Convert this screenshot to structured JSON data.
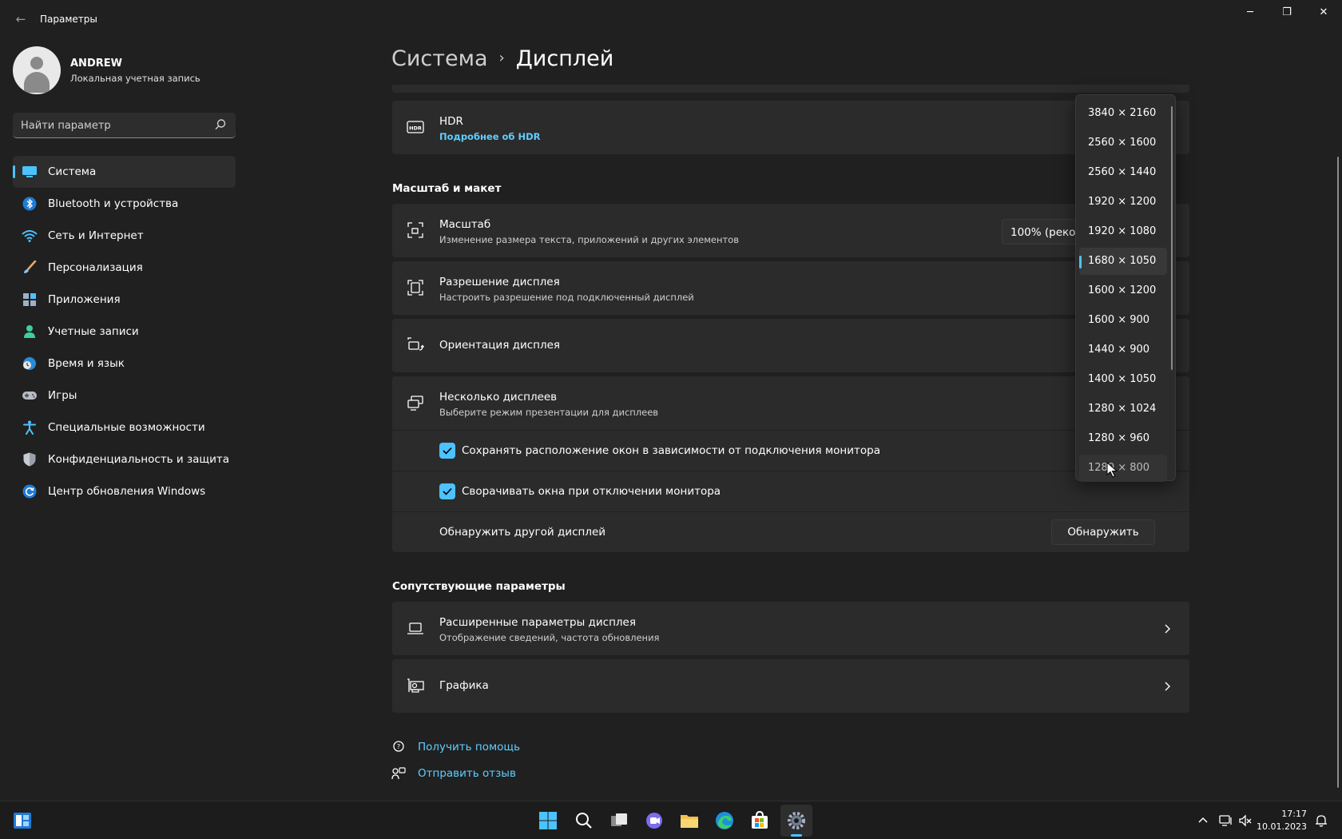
{
  "window": {
    "title": "Параметры",
    "minimize_glyph": "─",
    "maximize_glyph": "❐",
    "close_glyph": "✕",
    "back_glyph": "←"
  },
  "profile": {
    "name": "ANDREW",
    "account_type": "Локальная учетная запись"
  },
  "search": {
    "placeholder": "Найти параметр"
  },
  "nav": {
    "items": [
      {
        "label": "Система",
        "icon": "monitor-icon",
        "active": true
      },
      {
        "label": "Bluetooth и устройства",
        "icon": "bluetooth-icon"
      },
      {
        "label": "Сеть и Интернет",
        "icon": "wifi-icon"
      },
      {
        "label": "Персонализация",
        "icon": "brush-icon"
      },
      {
        "label": "Приложения",
        "icon": "apps-icon"
      },
      {
        "label": "Учетные записи",
        "icon": "person-icon"
      },
      {
        "label": "Время и язык",
        "icon": "clock-globe-icon"
      },
      {
        "label": "Игры",
        "icon": "gamepad-icon"
      },
      {
        "label": "Специальные возможности",
        "icon": "accessibility-icon"
      },
      {
        "label": "Конфиденциальность и защита",
        "icon": "shield-icon"
      },
      {
        "label": "Центр обновления Windows",
        "icon": "update-icon"
      }
    ]
  },
  "breadcrumb": {
    "parent": "Система",
    "separator": "›",
    "current": "Дисплей"
  },
  "hdr": {
    "title": "HDR",
    "link": "Подробнее об HDR"
  },
  "scale_layout": {
    "section_title": "Масштаб и макет",
    "scale": {
      "title": "Масштаб",
      "subtitle": "Изменение размера текста, приложений и других элементов",
      "value": "100% (рекомендуется)"
    },
    "resolution": {
      "title": "Разрешение дисплея",
      "subtitle": "Настроить разрешение под подключенный дисплей"
    },
    "orientation": {
      "title": "Ориентация дисплея"
    },
    "multiple": {
      "title": "Несколько дисплеев",
      "subtitle": "Выберите режим презентации для дисплеев",
      "option1": "Сохранять расположение окон в зависимости от подключения монитора",
      "option2": "Сворачивать окна при отключении монитора",
      "detect_label": "Обнаружить другой дисплей",
      "detect_button": "Обнаружить"
    }
  },
  "resolution_dropdown": {
    "options": [
      "3840 × 2160",
      "2560 × 1600",
      "2560 × 1440",
      "1920 × 1200",
      "1920 × 1080",
      "1680 × 1050",
      "1600 × 1200",
      "1600 × 900",
      "1440 × 900",
      "1400 × 1050",
      "1280 × 1024",
      "1280 × 960",
      "1280 × 800"
    ],
    "selected": "1680 × 1050",
    "hovered": "1280 × 800"
  },
  "related": {
    "section_title": "Сопутствующие параметры",
    "advanced": {
      "title": "Расширенные параметры дисплея",
      "subtitle": "Отображение сведений, частота обновления"
    },
    "graphics": {
      "title": "Графика"
    }
  },
  "footer": {
    "help": "Получить помощь",
    "feedback": "Отправить отзыв"
  },
  "taskbar": {
    "time": "17:17",
    "date": "10.01.2023",
    "accent": "#4cc2ff"
  }
}
